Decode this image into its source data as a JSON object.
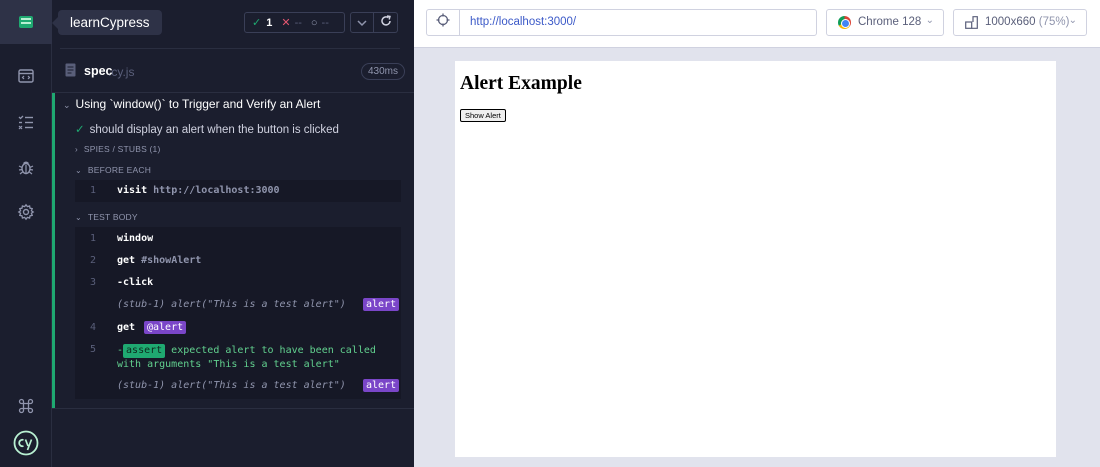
{
  "app": {
    "project_name": "learnCypress"
  },
  "sidebar": {
    "items": [
      {
        "icon": "specs-icon"
      },
      {
        "icon": "runs-icon"
      },
      {
        "icon": "debug-icon"
      },
      {
        "icon": "settings-icon"
      },
      {
        "icon": "keyboard-shortcuts-icon"
      },
      {
        "icon": "cypress-logo-icon"
      }
    ]
  },
  "reporter": {
    "stats": {
      "passed": "1",
      "failed": "--",
      "pending": "--"
    },
    "spec": {
      "name": "spec",
      "ext": ".cy.js",
      "duration": "430ms"
    },
    "suite": {
      "title": "Using `window()` to Trigger and Verify an Alert",
      "test_title": "should display an alert when the button is clicked",
      "spies_label": "SPIES / STUBS (1)",
      "before_each_label": "BEFORE EACH",
      "test_body_label": "TEST BODY",
      "before_each": [
        {
          "num": "1",
          "name": "visit",
          "msg": "http://localhost:3000"
        }
      ],
      "test_body": {
        "cmd1": {
          "num": "1",
          "name": "window"
        },
        "cmd2": {
          "num": "2",
          "name": "get",
          "msg": "#showAlert"
        },
        "cmd3": {
          "num": "3",
          "name": "-click"
        },
        "stub1": {
          "text": "(stub-1)  alert(\"This is a test alert\")",
          "badge": "alert"
        },
        "cmd4": {
          "num": "4",
          "name": "get",
          "badge": "@alert"
        },
        "cmd5": {
          "num": "5",
          "prefix": "-",
          "badge": "assert",
          "line1": " expected alert to have been called",
          "line2": "with arguments \"This is a test alert\""
        },
        "stub2": {
          "text": "(stub-1)  alert(\"This is a test alert\")",
          "badge": "alert"
        }
      }
    }
  },
  "browser": {
    "url": "http://localhost:3000/",
    "browser_name": "Chrome 128",
    "viewport": "1000x660",
    "scale": "(75%)"
  },
  "aut": {
    "heading": "Alert Example",
    "button_label": "Show Alert"
  }
}
